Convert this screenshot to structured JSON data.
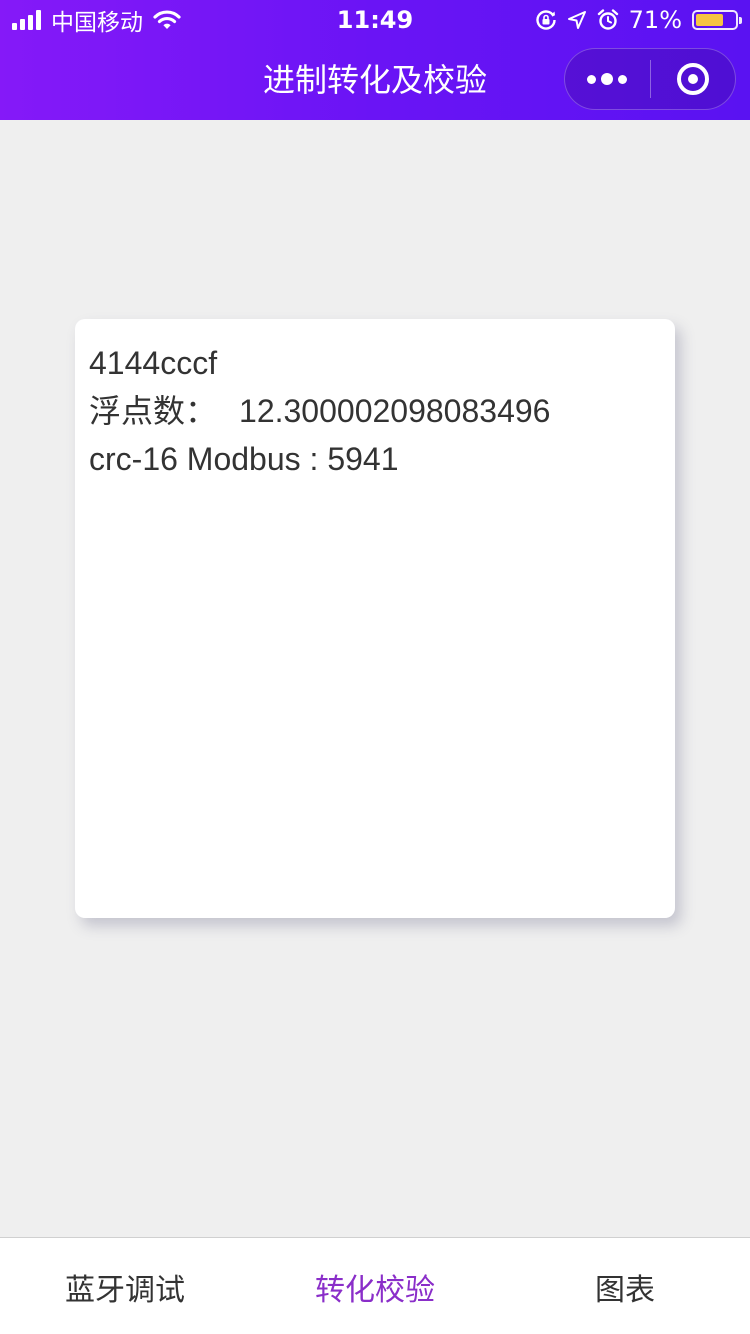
{
  "status_bar": {
    "carrier": "中国移动",
    "time": "11:49",
    "battery_text": "71%",
    "battery_level": 0.71,
    "icons": [
      "signal-icon",
      "wifi-icon",
      "orientation-lock-icon",
      "location-icon",
      "alarm-icon",
      "battery-icon"
    ]
  },
  "nav": {
    "title": "进制转化及校验",
    "capsule": {
      "more_icon": "more-dots-icon",
      "close_icon": "target-icon"
    }
  },
  "result": {
    "hex": "4144cccf",
    "float_label": "浮点数：",
    "float_value": "12.300002098083496",
    "crc_text": "crc-16 Modbus : 5941"
  },
  "tabbar": {
    "active_color": "#8a2ec9",
    "tabs": [
      {
        "label": "蓝牙调试",
        "active": false
      },
      {
        "label": "转化校验",
        "active": true
      },
      {
        "label": "图表",
        "active": false
      }
    ]
  }
}
